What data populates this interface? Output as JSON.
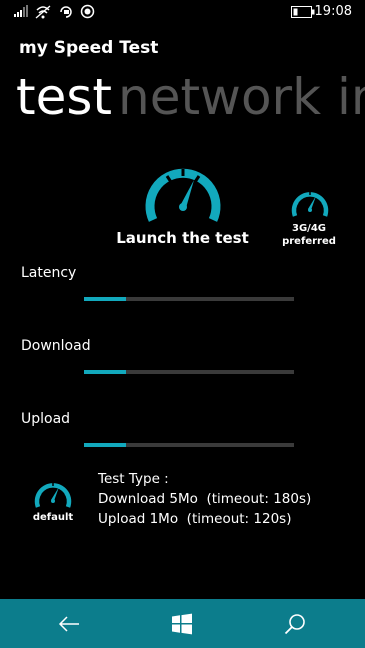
{
  "status_bar": {
    "time": "19:08",
    "icons": [
      "signal-icon",
      "wifi-icon",
      "rotation-lock-icon",
      "record-icon",
      "battery-icon"
    ]
  },
  "app": {
    "title": "my Speed Test"
  },
  "pivot": {
    "tabs": [
      {
        "label": "test",
        "active": true
      },
      {
        "label": "network in",
        "active": false
      }
    ]
  },
  "launch": {
    "label": "Launch the test",
    "icon": "speedometer-icon"
  },
  "preferred": {
    "line1": "3G/4G",
    "line2": "preferred",
    "icon": "speedometer-icon"
  },
  "metrics": [
    {
      "label": "Latency",
      "progress": 0.2
    },
    {
      "label": "Download",
      "progress": 0.2
    },
    {
      "label": "Upload",
      "progress": 0.2
    }
  ],
  "test_type": {
    "badge": "default",
    "heading": "Test Type :",
    "download": "Download 5Mo  (timeout: 180s)",
    "upload": "Upload 1Mo  (timeout: 120s)"
  },
  "nav_bar": {
    "buttons": [
      "back-icon",
      "windows-start-icon",
      "search-icon"
    ]
  },
  "colors": {
    "accent": "#12a9bd",
    "nav_bar": "#0c7d8c",
    "track": "#3a3a3a",
    "inactive_pivot": "#555555"
  }
}
